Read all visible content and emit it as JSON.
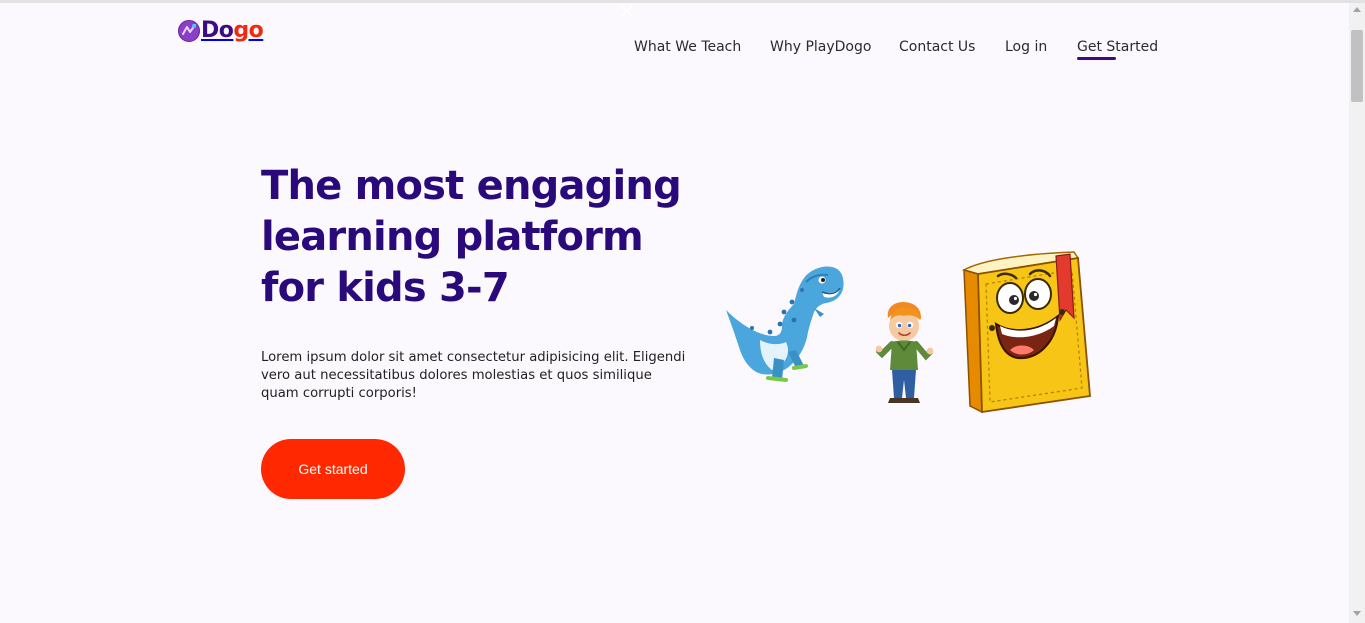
{
  "window": {
    "close_glyph": "✕"
  },
  "brand": {
    "name_part1": "Do",
    "name_part2": "go",
    "icon": "planet-logo-icon",
    "color_primary": "#3b0d84",
    "color_accent": "#f02a10"
  },
  "nav": {
    "links": [
      {
        "label": "What We Teach"
      },
      {
        "label": "Why PlayDogo"
      },
      {
        "label": "Contact Us"
      },
      {
        "label": "Log in"
      },
      {
        "label": "Get Started",
        "active": true
      }
    ]
  },
  "hero": {
    "title": "The most engaging learning platform for kids 3-7",
    "description": "Lorem ipsum dolor sit amet consectetur adipisicing elit. Eligendi vero aut necessitatibus dolores molestias et quos similique quam corrupti corporis!",
    "cta_label": "Get started",
    "cta_color": "#ff2800",
    "title_color": "#2a0a7a",
    "illustrations": [
      "dinosaur-illustration",
      "boy-illustration",
      "book-character-illustration"
    ]
  }
}
